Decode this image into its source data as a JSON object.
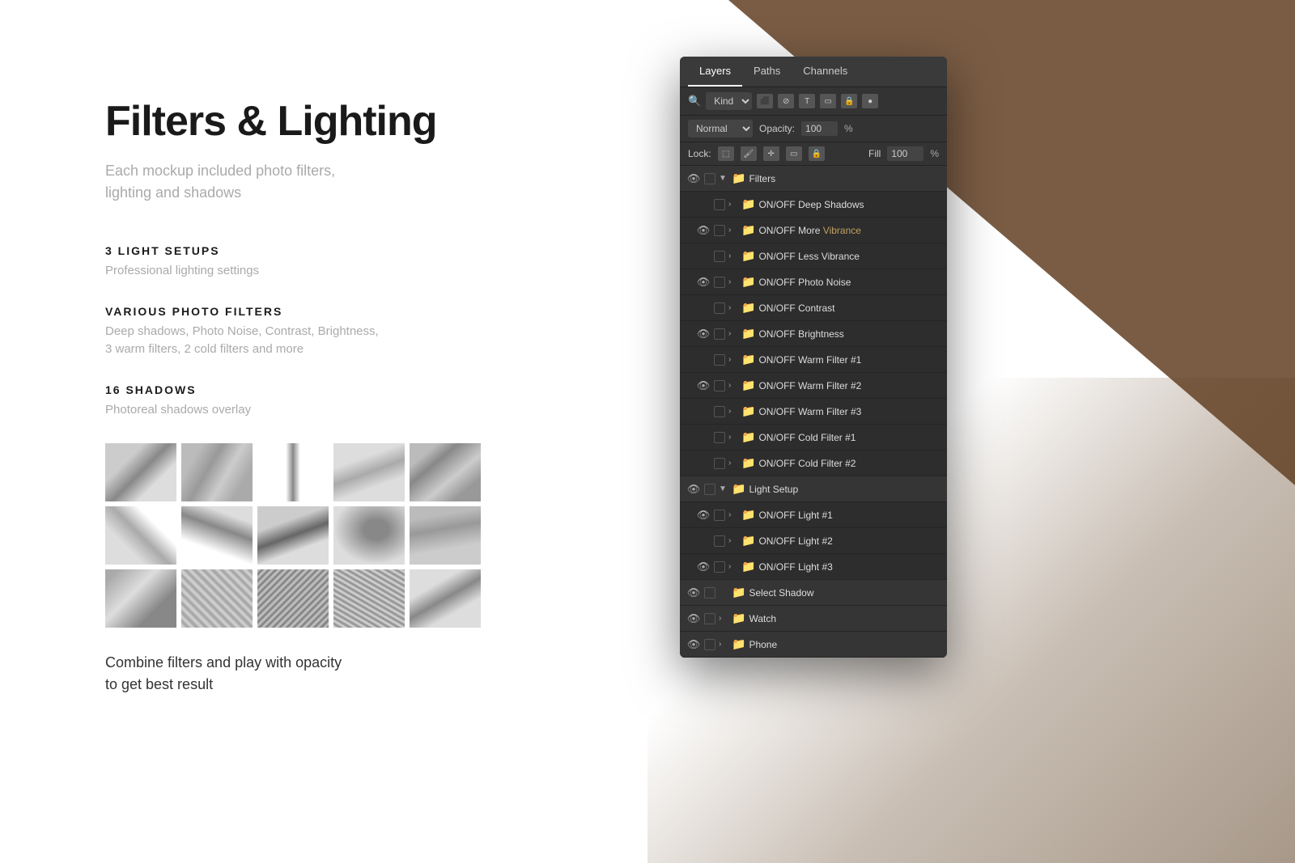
{
  "background": {
    "triangle_color": "#7a5c44"
  },
  "content": {
    "main_title": "Filters & Lighting",
    "main_subtitle": "Each mockup included photo filters,\nlighting and shadows",
    "sections": [
      {
        "id": "light-setups",
        "title": "3 LIGHT SETUPS",
        "description": "Professional lighting settings"
      },
      {
        "id": "photo-filters",
        "title": "VARIOUS PHOTO FILTERS",
        "description": "Deep shadows, Photo Noise, Contrast, Brightness,\n3 warm filters, 2 cold filters and more"
      },
      {
        "id": "shadows",
        "title": "16 SHADOWS",
        "description": "Photoreal shadows overlay"
      }
    ],
    "bottom_text": "Combine filters and play with opacity\nto get best result"
  },
  "ps_panel": {
    "tabs": [
      {
        "label": "Layers",
        "active": true
      },
      {
        "label": "Paths",
        "active": false
      },
      {
        "label": "Channels",
        "active": false
      }
    ],
    "toolbar": {
      "search_placeholder": "Kind",
      "icons": [
        "image-icon",
        "circle-slash-icon",
        "text-icon",
        "crop-icon",
        "lock-icon",
        "circle-icon"
      ]
    },
    "opacity_row": {
      "blend_mode": "Normal",
      "opacity_label": "Opacity:",
      "opacity_value": "100"
    },
    "lock_row": {
      "label": "Lock:",
      "fill_label": "Fill",
      "fill_value": "100"
    },
    "layers": [
      {
        "id": "filters-group",
        "eye": true,
        "checkbox": false,
        "chevron": true,
        "folder": true,
        "name": "Filters",
        "level": 0,
        "is_group": true
      },
      {
        "id": "deep-shadows",
        "eye": false,
        "checkbox": false,
        "chevron": true,
        "folder": true,
        "name": "ON/OFF Deep Shadows",
        "level": 1
      },
      {
        "id": "more-vibrance",
        "eye": true,
        "checkbox": false,
        "chevron": true,
        "folder": true,
        "name": "ON/OFF More Vibrance",
        "level": 1,
        "highlight": true
      },
      {
        "id": "less-vibrance",
        "eye": false,
        "checkbox": false,
        "chevron": true,
        "folder": true,
        "name": "ON/OFF Less Vibrance",
        "level": 1
      },
      {
        "id": "photo-noise",
        "eye": true,
        "checkbox": false,
        "chevron": true,
        "folder": true,
        "name": "ON/OFF Photo Noise",
        "level": 1
      },
      {
        "id": "contrast",
        "eye": false,
        "checkbox": false,
        "chevron": true,
        "folder": true,
        "name": "ON/OFF Contrast",
        "level": 1
      },
      {
        "id": "brightness",
        "eye": true,
        "checkbox": false,
        "chevron": true,
        "folder": true,
        "name": "ON/OFF Brightness",
        "level": 1
      },
      {
        "id": "warm-filter-1",
        "eye": false,
        "checkbox": false,
        "chevron": true,
        "folder": true,
        "name": "ON/OFF Warm Filter #1",
        "level": 1
      },
      {
        "id": "warm-filter-2",
        "eye": true,
        "checkbox": false,
        "chevron": true,
        "folder": true,
        "name": "ON/OFF Warm Filter #2",
        "level": 1
      },
      {
        "id": "warm-filter-3",
        "eye": false,
        "checkbox": false,
        "chevron": true,
        "folder": true,
        "name": "ON/OFF Warm Filter #3",
        "level": 1
      },
      {
        "id": "cold-filter-1",
        "eye": false,
        "checkbox": false,
        "chevron": true,
        "folder": true,
        "name": "ON/OFF Cold Filter #1",
        "level": 1
      },
      {
        "id": "cold-filter-2",
        "eye": false,
        "checkbox": false,
        "chevron": true,
        "folder": true,
        "name": "ON/OFF Cold Filter #2",
        "level": 1
      },
      {
        "id": "light-setup-group",
        "eye": true,
        "checkbox": false,
        "chevron": true,
        "folder": true,
        "name": "Light Setup",
        "level": 0,
        "is_group": true
      },
      {
        "id": "light-1",
        "eye": true,
        "checkbox": false,
        "chevron": true,
        "folder": true,
        "name": "ON/OFF Light #1",
        "level": 1
      },
      {
        "id": "light-2",
        "eye": false,
        "checkbox": false,
        "chevron": true,
        "folder": true,
        "name": "ON/OFF Light #2",
        "level": 1
      },
      {
        "id": "light-3",
        "eye": true,
        "checkbox": false,
        "chevron": true,
        "folder": true,
        "name": "ON/OFF Light #3",
        "level": 1
      },
      {
        "id": "select-shadow-group",
        "eye": true,
        "checkbox": false,
        "chevron": false,
        "folder": true,
        "name": "Select Shadow",
        "level": 0,
        "is_group": true
      },
      {
        "id": "watch-group",
        "eye": true,
        "checkbox": false,
        "chevron": true,
        "folder": true,
        "name": "Watch",
        "level": 0,
        "is_group": true
      },
      {
        "id": "phone-group",
        "eye": true,
        "checkbox": false,
        "chevron": true,
        "folder": true,
        "name": "Phone",
        "level": 0,
        "is_group": true
      }
    ]
  }
}
